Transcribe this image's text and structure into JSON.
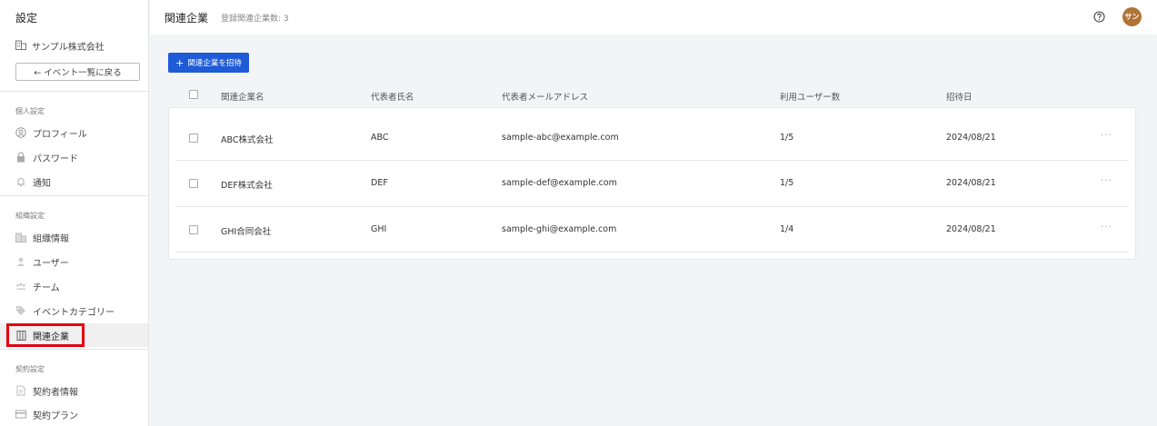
{
  "sidebar": {
    "title": "設定",
    "org_name": "サンプル株式会社",
    "back_label": "← イベント一覧に戻る",
    "sections": {
      "personal": "個人設定",
      "organization": "組織設定",
      "contract": "契約設定"
    },
    "items": {
      "profile": "プロフィール",
      "password": "パスワード",
      "notification": "通知",
      "org_info": "組織情報",
      "users": "ユーザー",
      "team": "チーム",
      "event_category": "イベントカテゴリー",
      "related_companies": "関連企業",
      "contractor_info": "契約者情報",
      "contract_plan": "契約プラン"
    }
  },
  "header": {
    "title": "関連企業",
    "count_text": "登録関連企業数: 3",
    "avatar_text": "サン"
  },
  "toolbar": {
    "invite_label": "関連企業を招待"
  },
  "table": {
    "headers": {
      "company": "関連企業名",
      "representative": "代表者氏名",
      "email": "代表者メールアドレス",
      "users": "利用ユーザー数",
      "invited": "招待日"
    },
    "rows": [
      {
        "company": "ABC株式会社",
        "representative": "ABC",
        "email": "sample-abc@example.com",
        "users": "1/5",
        "invited": "2024/08/21"
      },
      {
        "company": "DEF株式会社",
        "representative": "DEF",
        "email": "sample-def@example.com",
        "users": "1/5",
        "invited": "2024/08/21"
      },
      {
        "company": "GHI合同会社",
        "representative": "GHI",
        "email": "sample-ghi@example.com",
        "users": "1/4",
        "invited": "2024/08/21"
      }
    ],
    "more_label": "···"
  },
  "colors": {
    "primary": "#1e5bd6",
    "highlight": "#e10010",
    "avatar": "#b07438"
  }
}
